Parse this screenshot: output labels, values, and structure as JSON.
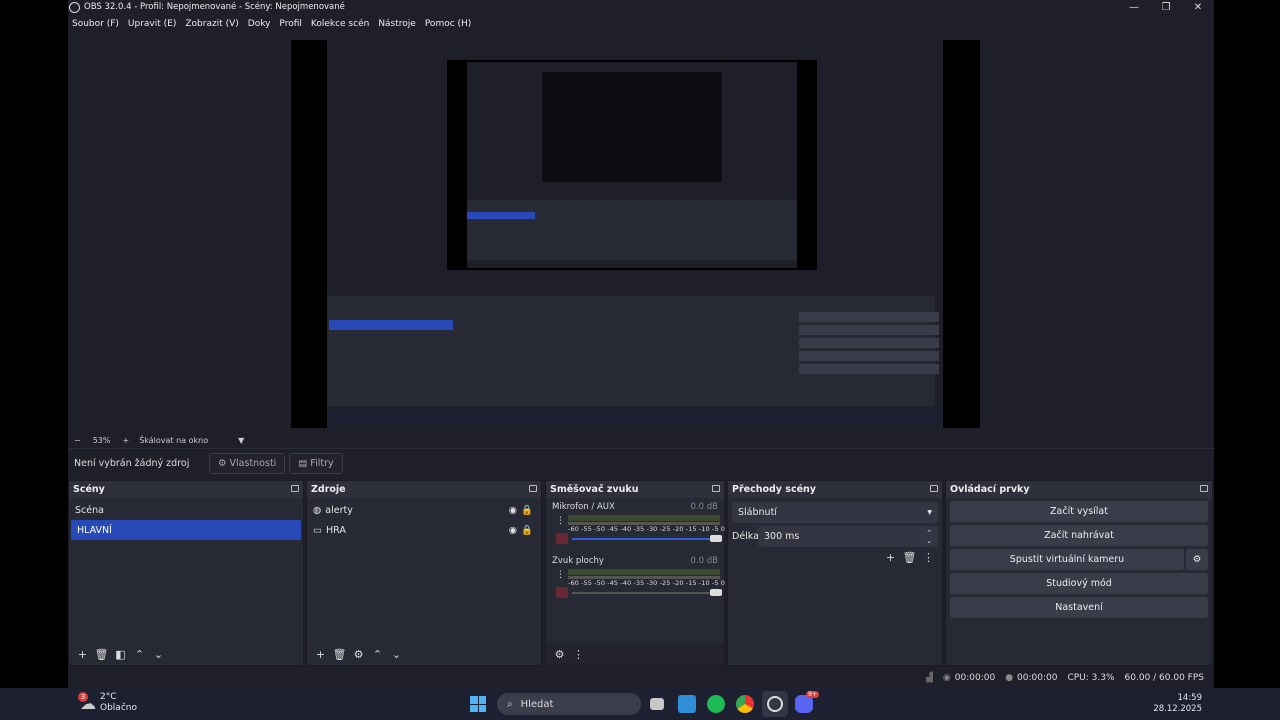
{
  "window": {
    "title": "OBS 32.0.4 - Profil: Nepojmenované - Scény: Nepojmenované",
    "controls": [
      "—",
      "❐",
      "✕"
    ]
  },
  "menu": [
    "Soubor (F)",
    "Upravit (E)",
    "Zobrazit (V)",
    "Doky",
    "Profil",
    "Kolekce scén",
    "Nástroje",
    "Pomoc (H)"
  ],
  "zoom": {
    "minus": "−",
    "value": "53%",
    "plus": "+",
    "mode": "Škálovat na okno"
  },
  "source_toolbar": {
    "status": "Není vybrán žádný zdroj",
    "properties": "Vlastnosti",
    "filters": "Filtry"
  },
  "scenes": {
    "title": "Scény",
    "items": [
      "Scéna",
      "HLAVNÍ"
    ],
    "selected": 1
  },
  "sources": {
    "title": "Zdroje",
    "items": [
      {
        "name": "alerty",
        "icon": "globe-icon"
      },
      {
        "name": "HRA",
        "icon": "monitor-icon"
      }
    ]
  },
  "mixer": {
    "title": "Směšovač zvuku",
    "channels": [
      {
        "name": "Mikrofon / AUX",
        "db": "0.0 dB",
        "volume": 1.0
      },
      {
        "name": "Zvuk plochy",
        "db": "0.0 dB",
        "volume": 1.0
      }
    ],
    "scale": "-60 -55 -50 -45 -40 -35 -30 -25 -20 -15 -10 -5 0"
  },
  "transitions": {
    "title": "Přechody scény",
    "selected": "Slábnutí",
    "duration_label": "Délka",
    "duration": "300 ms"
  },
  "controls": {
    "title": "Ovládací prvky",
    "buttons": [
      "Začít vysílat",
      "Začít nahrávat",
      "Spustit virtuální kameru",
      "Studiový mód",
      "Nastavení"
    ]
  },
  "status": {
    "stream_time": "00:00:00",
    "rec_time": "00:00:00",
    "cpu": "CPU: 3.3%",
    "fps": "60.00 / 60.00 FPS"
  },
  "taskbar": {
    "weather_temp": "2°C",
    "weather_desc": "Oblačno",
    "weather_badge": "3",
    "search_placeholder": "Hledat",
    "time": "14:59",
    "date": "28.12.2025",
    "discord_badge": "9+"
  }
}
